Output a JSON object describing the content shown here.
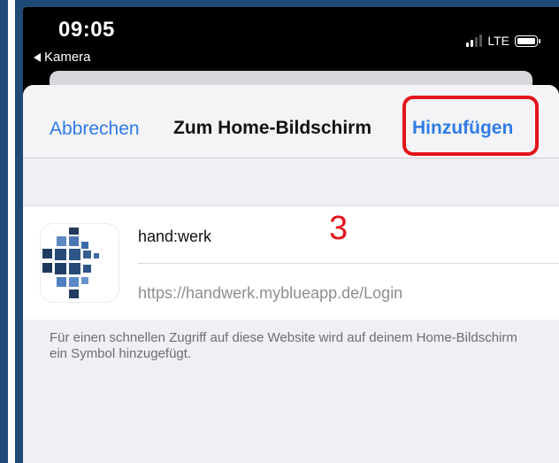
{
  "status_bar": {
    "time": "09:05",
    "back_app": "Kamera",
    "network": "LTE"
  },
  "nav": {
    "cancel_label": "Abbrechen",
    "title": "Zum Home-Bildschirm",
    "add_label": "Hinzufügen"
  },
  "entry": {
    "name": "hand:werk",
    "url": "https://handwerk.myblueapp.de/Login"
  },
  "annotation": {
    "step_number": "3"
  },
  "footnote": "Für einen schnellen Zugriff auf diese Website wird auf deinem Home-Bildschirm ein Symbol hinzugefügt.",
  "colors": {
    "accent": "#2f7be6",
    "highlight": "#e3141b",
    "frame": "#1f4a78"
  }
}
